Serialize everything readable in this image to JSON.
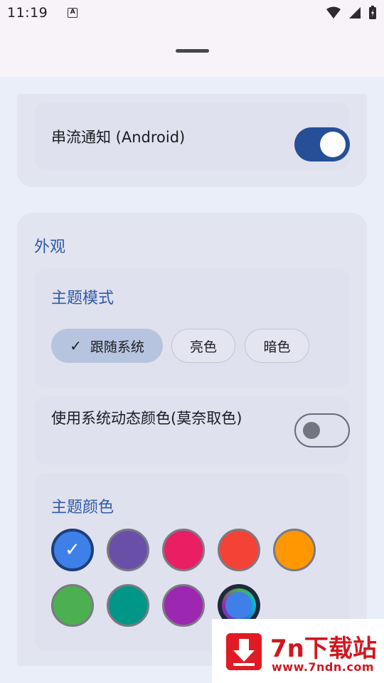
{
  "status_bar": {
    "time": "11:19",
    "notification_icon": "A"
  },
  "stream_notification": {
    "label": "串流通知 (Android)",
    "enabled": true
  },
  "appearance": {
    "title": "外观",
    "theme_mode": {
      "title": "主题模式",
      "options": [
        "跟随系统",
        "亮色",
        "暗色"
      ],
      "selected": "跟随系统"
    },
    "dynamic_color": {
      "label": "使用系统动态颜色(莫奈取色)",
      "enabled": false
    },
    "theme_color": {
      "title": "主题颜色",
      "colors": [
        "#3f7fe8",
        "#6a4fa8",
        "#e91e63",
        "#f44336",
        "#ff9800",
        "#4caf50",
        "#009688",
        "#9c27b0",
        "dynamic"
      ],
      "selected_index": 0
    }
  },
  "watermark": {
    "title": "7n下载站",
    "url": "www.7ndn.com"
  },
  "icons": [
    "wifi-icon",
    "signal-icon",
    "battery-icon",
    "check-icon",
    "download-arrow-icon"
  ]
}
